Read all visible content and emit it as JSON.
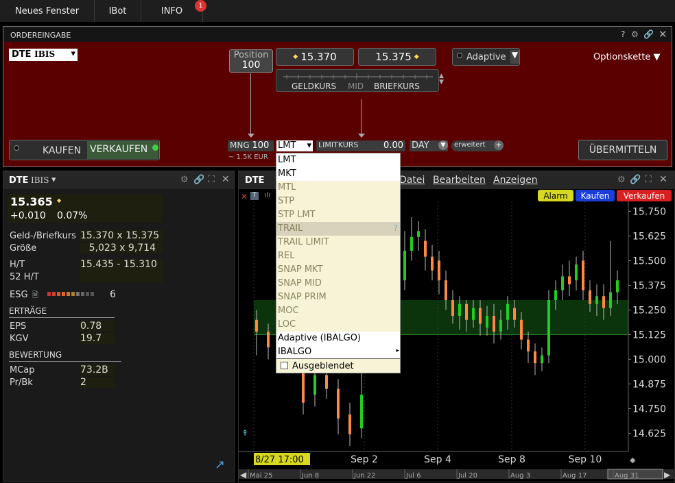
{
  "topbar": {
    "new_window": "Neues Fenster",
    "ibot": "IBot",
    "info": "INFO",
    "info_badge": "1"
  },
  "order": {
    "title": "ORDEREINGABE",
    "help": "?",
    "symbol": "DTE",
    "exchange": "IBIS",
    "position_label": "Position",
    "position_value": "100",
    "bid": "15.370",
    "ask": "15.375",
    "bid_label": "GELDKURS",
    "mid_label": "MID",
    "ask_label": "BRIEFKURS",
    "algo": "Adaptive",
    "options_chain": "Optionskette ▼",
    "buy": "KAUFEN",
    "sell": "VERKAUFEN",
    "qty_label": "MNG",
    "qty": "100",
    "notional": "~ 1.5K EUR",
    "order_type": "LMT",
    "limit_label": "LIMITKURS",
    "limit_value": "0.00",
    "tif": "DAY",
    "advanced": "erweitert",
    "submit": "ÜBERMITTELN"
  },
  "order_types": {
    "items": [
      {
        "label": "LMT",
        "state": "normal"
      },
      {
        "label": "MKT",
        "state": "normal"
      },
      {
        "label": "MTL",
        "state": "disabled"
      },
      {
        "label": "STP",
        "state": "disabled"
      },
      {
        "label": "STP LMT",
        "state": "disabled"
      },
      {
        "label": "TRAIL",
        "state": "highlight"
      },
      {
        "label": "TRAIL LIMIT",
        "state": "disabled"
      },
      {
        "label": "REL",
        "state": "disabled"
      },
      {
        "label": "SNAP MKT",
        "state": "disabled"
      },
      {
        "label": "SNAP MID",
        "state": "disabled"
      },
      {
        "label": "SNAP PRIM",
        "state": "disabled"
      },
      {
        "label": "MOC",
        "state": "disabled"
      },
      {
        "label": "LOC",
        "state": "disabled"
      },
      {
        "label": "Adaptive (IBALGO)",
        "state": "white"
      },
      {
        "label": "IBALGO",
        "state": "white"
      }
    ],
    "help_mark": "?",
    "hidden_label": "Ausgeblendet"
  },
  "quote": {
    "symbol": "DTE",
    "exchange": "IBIS",
    "last": "15.365",
    "change": "+0.010",
    "change_pct": "0.07%",
    "bidask_label": "Geld-/Briefkurs",
    "bidask_value": "15.370 x 15.375",
    "size_label": "Größe",
    "size_value": "5,023 x 9,714",
    "hl_label": "H/T",
    "hl_value": "15.435 - 15.310",
    "hl52_label": "52 H/T",
    "esg_label": "ESG",
    "esg_value": "6",
    "earnings_header": "ERTRÄGE",
    "eps_label": "EPS",
    "eps_value": "0.78",
    "pe_label": "KGV",
    "pe_value": "19.7",
    "valuation_header": "BEWERTUNG",
    "mcap_label": "MCap",
    "mcap_value": "73.2B",
    "pb_label": "Pr/Bk",
    "pb_value": "2"
  },
  "chart": {
    "symbol": "DTE",
    "menu_file": "Datei",
    "menu_edit": "Bearbeiten",
    "menu_view": "Anzeigen",
    "alarm": "Alarm",
    "buy": "Kaufen",
    "sell": "Verkaufen",
    "cursor_time": "8/27 17:00",
    "x_labels": [
      "Sep 2",
      "Sep 4",
      "Sep 8",
      "Sep 10"
    ],
    "nav_labels": [
      "Mai 25",
      "Jun 8",
      "Jun 22",
      "Jul 6",
      "Jul 20",
      "Aug 3",
      "Aug 17",
      "Aug 31"
    ],
    "colors": {
      "up": "#22cc22",
      "down": "#ff8844",
      "band": "#0d3a0d"
    }
  },
  "chart_data": {
    "type": "candlestick",
    "y_ticks": [
      15.75,
      15.625,
      15.5,
      15.375,
      15.25,
      15.125,
      15.0,
      14.875,
      14.75,
      14.625
    ],
    "ylim": [
      14.55,
      15.8
    ],
    "band": [
      15.125,
      15.3
    ],
    "candles": [
      {
        "o": 15.2,
        "c": 15.14,
        "h": 15.25,
        "l": 15.02
      },
      {
        "o": 15.14,
        "c": 15.06,
        "h": 15.18,
        "l": 15.0
      },
      {
        "o": 15.08,
        "c": 15.12,
        "h": 15.18,
        "l": 15.04
      },
      {
        "o": 15.12,
        "c": 15.05,
        "h": 15.2,
        "l": 15.0
      },
      {
        "o": 14.95,
        "c": 14.78,
        "h": 15.0,
        "l": 14.72
      },
      {
        "o": 14.82,
        "c": 14.92,
        "h": 14.98,
        "l": 14.76
      },
      {
        "o": 14.92,
        "c": 14.85,
        "h": 15.0,
        "l": 14.8
      },
      {
        "o": 14.85,
        "c": 14.7,
        "h": 14.9,
        "l": 14.62
      },
      {
        "o": 14.72,
        "c": 14.62,
        "h": 14.78,
        "l": 14.56
      },
      {
        "o": 14.65,
        "c": 14.82,
        "h": 14.95,
        "l": 14.6
      },
      {
        "o": 15.2,
        "c": 15.4,
        "h": 15.45,
        "l": 15.15
      },
      {
        "o": 15.4,
        "c": 15.55,
        "h": 15.65,
        "l": 15.35
      },
      {
        "o": 15.55,
        "c": 15.62,
        "h": 15.72,
        "l": 15.5
      },
      {
        "o": 15.62,
        "c": 15.65,
        "h": 15.7,
        "l": 15.55
      },
      {
        "o": 15.6,
        "c": 15.52,
        "h": 15.66,
        "l": 15.45
      },
      {
        "o": 15.52,
        "c": 15.45,
        "h": 15.58,
        "l": 15.4
      },
      {
        "o": 15.5,
        "c": 15.4,
        "h": 15.55,
        "l": 15.33
      },
      {
        "o": 15.4,
        "c": 15.3,
        "h": 15.45,
        "l": 15.25
      },
      {
        "o": 15.3,
        "c": 15.22,
        "h": 15.35,
        "l": 15.18
      },
      {
        "o": 15.22,
        "c": 15.28,
        "h": 15.32,
        "l": 15.15
      },
      {
        "o": 15.28,
        "c": 15.2,
        "h": 15.3,
        "l": 15.14
      },
      {
        "o": 15.2,
        "c": 15.26,
        "h": 15.3,
        "l": 15.16
      },
      {
        "o": 15.26,
        "c": 15.18,
        "h": 15.3,
        "l": 15.12
      },
      {
        "o": 15.16,
        "c": 15.22,
        "h": 15.27,
        "l": 15.12
      },
      {
        "o": 15.22,
        "c": 15.14,
        "h": 15.28,
        "l": 15.08
      },
      {
        "o": 15.14,
        "c": 15.2,
        "h": 15.25,
        "l": 15.1
      },
      {
        "o": 15.2,
        "c": 15.28,
        "h": 15.32,
        "l": 15.15
      },
      {
        "o": 15.26,
        "c": 15.2,
        "h": 15.3,
        "l": 15.16
      },
      {
        "o": 15.2,
        "c": 15.1,
        "h": 15.24,
        "l": 15.05
      },
      {
        "o": 15.1,
        "c": 15.04,
        "h": 15.14,
        "l": 14.98
      },
      {
        "o": 15.04,
        "c": 14.98,
        "h": 15.08,
        "l": 14.92
      },
      {
        "o": 14.98,
        "c": 15.02,
        "h": 15.06,
        "l": 14.94
      },
      {
        "o": 15.02,
        "c": 15.3,
        "h": 15.35,
        "l": 14.98
      },
      {
        "o": 15.3,
        "c": 15.35,
        "h": 15.4,
        "l": 15.25
      },
      {
        "o": 15.35,
        "c": 15.42,
        "h": 15.48,
        "l": 15.3
      },
      {
        "o": 15.42,
        "c": 15.38,
        "h": 15.5,
        "l": 15.32
      },
      {
        "o": 15.4,
        "c": 15.48,
        "h": 15.52,
        "l": 15.35
      },
      {
        "o": 15.5,
        "c": 15.35,
        "h": 15.55,
        "l": 15.3
      },
      {
        "o": 15.35,
        "c": 15.28,
        "h": 15.4,
        "l": 15.24
      },
      {
        "o": 15.28,
        "c": 15.32,
        "h": 15.38,
        "l": 15.22
      },
      {
        "o": 15.32,
        "c": 15.26,
        "h": 15.38,
        "l": 15.2
      },
      {
        "o": 15.26,
        "c": 15.34,
        "h": 15.6,
        "l": 15.22
      },
      {
        "o": 15.34,
        "c": 15.4,
        "h": 15.45,
        "l": 15.28
      }
    ]
  }
}
